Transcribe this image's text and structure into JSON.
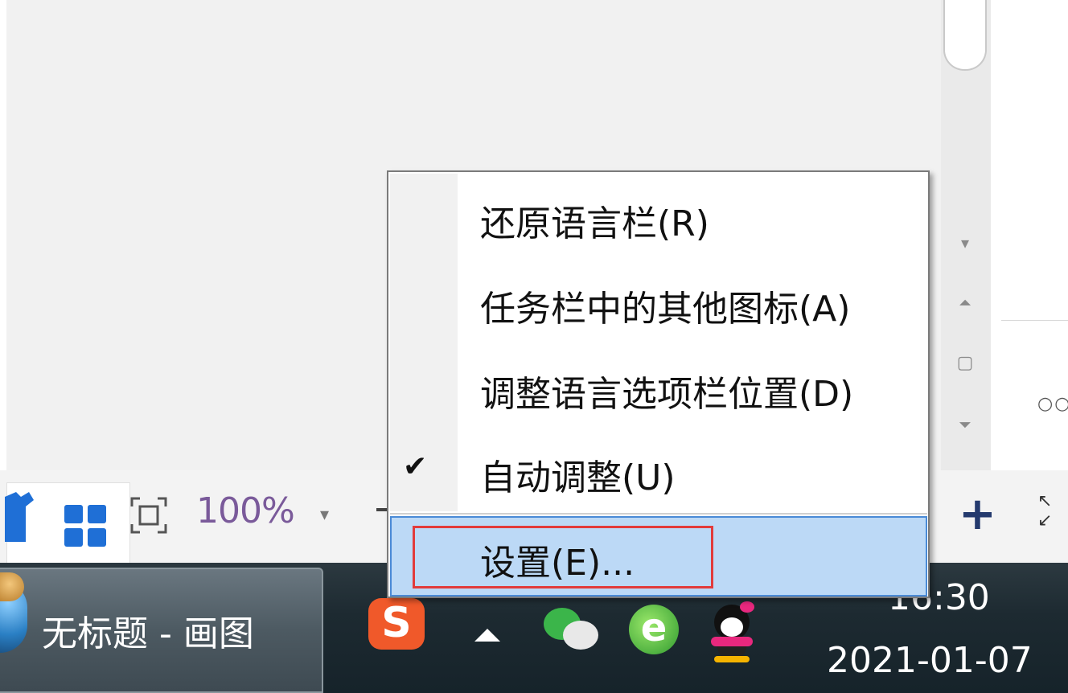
{
  "statusbar": {
    "zoom_label": "100%"
  },
  "taskbar": {
    "active_window_label": "无标题 - 画图",
    "clock_time": "16:30",
    "clock_date": "2021-01-07"
  },
  "context_menu": {
    "items": [
      {
        "label": "还原语言栏(R)",
        "checked": false,
        "highlighted": false
      },
      {
        "label": "任务栏中的其他图标(A)",
        "checked": false,
        "highlighted": false
      },
      {
        "label": "调整语言选项栏位置(D)",
        "checked": false,
        "highlighted": false
      },
      {
        "label": "自动调整(U)",
        "checked": true,
        "highlighted": false
      },
      {
        "label": "设置(E)...",
        "checked": false,
        "highlighted": true
      }
    ],
    "check_glyph": "✔",
    "highlight_color": "#bcd9f6",
    "annotation_color": "#e23b3b"
  },
  "icons": {
    "tray": [
      "sogou-input-icon",
      "tray-expand-icon",
      "wechat-icon",
      "ie-browser-icon",
      "qq-icon"
    ],
    "sogou_glyph": "S",
    "ie_glyph": "e"
  }
}
